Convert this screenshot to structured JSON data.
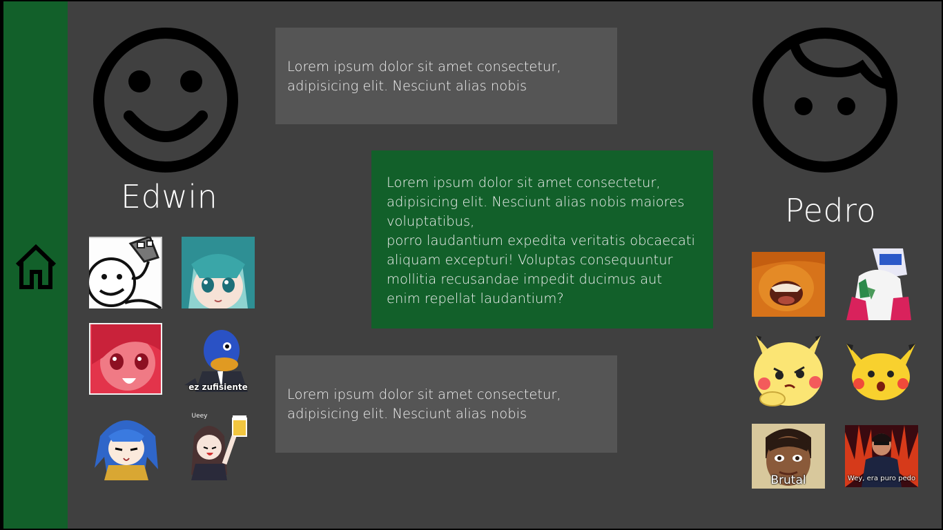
{
  "sidebar": {
    "home_icon": "home-icon",
    "color": "#12602a"
  },
  "left_user": {
    "name": "Edwin",
    "avatar_icon": "smiley-face-icon"
  },
  "right_user": {
    "name": "Pedro",
    "avatar_icon": "child-face-icon"
  },
  "messages": [
    {
      "sender": "left",
      "text": "Lorem ipsum dolor sit amet consectetur, adipisicing elit. Nesciunt alias nobis"
    },
    {
      "sender": "right",
      "lines": [
        "Lorem ipsum dolor sit amet consectetur, adipisicing elit. Nesciunt alias nobis maiores voluptatibus,",
        "porro laudantium expedita veritatis obcaecati aliquam excepturi! Voluptas consequuntur mollitia recusandae impedit ducimus aut enim repellat laudantium?"
      ]
    },
    {
      "sender": "left",
      "text": "Lorem ipsum dolor sit amet consectetur, adipisicing elit. Nesciunt alias nobis"
    }
  ],
  "left_stickers": [
    {
      "name": "meme-face-sticker",
      "caption": ""
    },
    {
      "name": "anime-teal-girl-sticker",
      "caption": ""
    },
    {
      "name": "anime-red-girl-sticker",
      "caption": ""
    },
    {
      "name": "blue-bird-sticker",
      "caption": "ez zufisiente"
    },
    {
      "name": "anime-blue-hair-sticker",
      "caption": ""
    },
    {
      "name": "anime-beer-girl-sticker",
      "caption": "Ueey"
    }
  ],
  "right_stickers": [
    {
      "name": "bee-face-sticker",
      "caption": ""
    },
    {
      "name": "anime-detergent-sticker",
      "caption": ""
    },
    {
      "name": "pikachu-thinking-sticker",
      "caption": ""
    },
    {
      "name": "pikachu-surprised-sticker",
      "caption": ""
    },
    {
      "name": "doll-face-sticker",
      "caption": "Brutal"
    },
    {
      "name": "man-stage-sticker",
      "caption": "Wey, era puro pedo"
    }
  ],
  "colors": {
    "background": "#404040",
    "bubble_grey": "#555555",
    "bubble_green": "#12602a",
    "text": "#ffffff"
  }
}
